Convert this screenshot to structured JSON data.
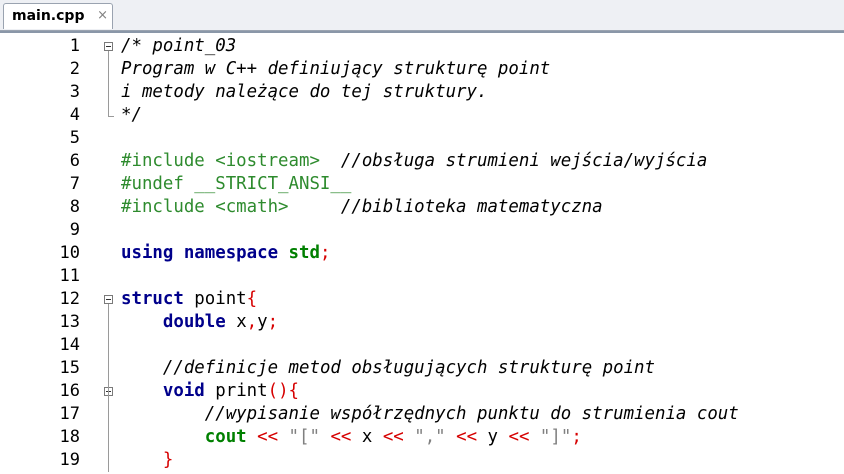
{
  "tab": {
    "filename": "main.cpp",
    "close_glyph": "×"
  },
  "colors": {
    "comment": "#000000",
    "preprocessor": "#2e8b2e",
    "keyword": "#00008b",
    "namespace": "#008000",
    "operator": "#d60000",
    "string": "#808080"
  },
  "lines": [
    {
      "n": "1",
      "fold": "open",
      "tokens": [
        {
          "t": "/* point_03",
          "c": "comment"
        }
      ]
    },
    {
      "n": "2",
      "tokens": [
        {
          "t": "Program w C++ definiujący strukturę point",
          "c": "comment"
        }
      ]
    },
    {
      "n": "3",
      "tokens": [
        {
          "t": "i metody należące do tej struktury.",
          "c": "comment"
        }
      ]
    },
    {
      "n": "4",
      "fold": "end",
      "tokens": [
        {
          "t": "*/",
          "c": "comment"
        }
      ]
    },
    {
      "n": "5",
      "tokens": []
    },
    {
      "n": "6",
      "tokens": [
        {
          "t": "#include <iostream>  ",
          "c": "pre"
        },
        {
          "t": "//obsługa strumieni wejścia/wyjścia",
          "c": "comment"
        }
      ]
    },
    {
      "n": "7",
      "tokens": [
        {
          "t": "#undef __STRICT_ANSI__",
          "c": "pre"
        }
      ]
    },
    {
      "n": "8",
      "tokens": [
        {
          "t": "#include <cmath>     ",
          "c": "pre"
        },
        {
          "t": "//biblioteka matematyczna",
          "c": "comment"
        }
      ]
    },
    {
      "n": "9",
      "tokens": []
    },
    {
      "n": "10",
      "tokens": [
        {
          "t": "using namespace ",
          "c": "kw"
        },
        {
          "t": "std",
          "c": "ns"
        },
        {
          "t": ";",
          "c": "op"
        }
      ]
    },
    {
      "n": "11",
      "tokens": []
    },
    {
      "n": "12",
      "fold": "open",
      "tokens": [
        {
          "t": "struct",
          "c": "kw"
        },
        {
          "t": " point",
          "c": "plain"
        },
        {
          "t": "{",
          "c": "op"
        }
      ]
    },
    {
      "n": "13",
      "tokens": [
        {
          "t": "    ",
          "c": "plain"
        },
        {
          "t": "double",
          "c": "kw"
        },
        {
          "t": " x",
          "c": "plain"
        },
        {
          "t": ",",
          "c": "op"
        },
        {
          "t": "y",
          "c": "plain"
        },
        {
          "t": ";",
          "c": "op"
        }
      ]
    },
    {
      "n": "14",
      "tokens": []
    },
    {
      "n": "15",
      "tokens": [
        {
          "t": "    ",
          "c": "plain"
        },
        {
          "t": "//definicje metod obsługujących strukturę point",
          "c": "comment"
        }
      ]
    },
    {
      "n": "16",
      "fold": "open",
      "tokens": [
        {
          "t": "    ",
          "c": "plain"
        },
        {
          "t": "void",
          "c": "kw"
        },
        {
          "t": " print",
          "c": "plain"
        },
        {
          "t": "(){",
          "c": "op"
        }
      ]
    },
    {
      "n": "17",
      "tokens": [
        {
          "t": "        ",
          "c": "plain"
        },
        {
          "t": "//wypisanie współrzędnych punktu do strumienia cout",
          "c": "comment"
        }
      ]
    },
    {
      "n": "18",
      "tokens": [
        {
          "t": "        ",
          "c": "plain"
        },
        {
          "t": "cout",
          "c": "ns"
        },
        {
          "t": " << ",
          "c": "op"
        },
        {
          "t": "\"[\"",
          "c": "str"
        },
        {
          "t": " << ",
          "c": "op"
        },
        {
          "t": "x",
          "c": "plain"
        },
        {
          "t": " << ",
          "c": "op"
        },
        {
          "t": "\",\"",
          "c": "str"
        },
        {
          "t": " << ",
          "c": "op"
        },
        {
          "t": "y",
          "c": "plain"
        },
        {
          "t": " << ",
          "c": "op"
        },
        {
          "t": "\"]\"",
          "c": "str"
        },
        {
          "t": ";",
          "c": "op"
        }
      ]
    },
    {
      "n": "19",
      "tokens": [
        {
          "t": "    ",
          "c": "plain"
        },
        {
          "t": "}",
          "c": "op"
        }
      ]
    }
  ]
}
